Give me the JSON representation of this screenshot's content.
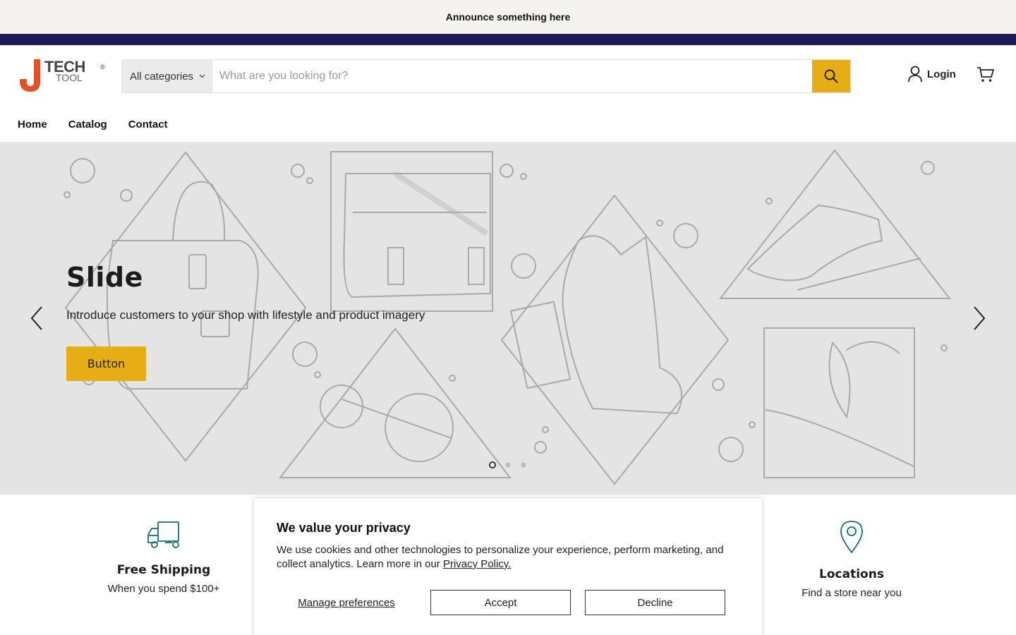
{
  "announcement": "Announce something here",
  "brand": {
    "tech": "TECH",
    "tool": "TOOL",
    "reg": "®",
    "accent": "#e2512a"
  },
  "search": {
    "category": "All categories",
    "placeholder": "What are you looking for?",
    "button_color": "#e6ad16"
  },
  "account": {
    "login_label": "Login"
  },
  "nav": {
    "items": [
      "Home",
      "Catalog",
      "Contact"
    ]
  },
  "hero": {
    "title": "Slide",
    "subtitle": "Introduce customers to your shop with lifestyle and product imagery",
    "button_label": "Button",
    "slides_total": 3,
    "active_slide": 1
  },
  "features": [
    {
      "icon": "truck-icon",
      "title": "Free Shipping",
      "subtitle": "When you spend $100+"
    },
    {
      "icon": "map-pin-icon",
      "title": "Locations",
      "subtitle": "Find a store near you"
    }
  ],
  "cookie": {
    "title": "We value your privacy",
    "text": "We use cookies and other technologies to personalize your experience, perform marketing, and collect analytics. Learn more in our ",
    "link_label": "Privacy Policy.",
    "manage_label": "Manage preferences",
    "accept_label": "Accept",
    "decline_label": "Decline"
  },
  "colors": {
    "navy": "#1b1a57",
    "accent_yellow": "#e6ad16",
    "icon_teal": "#1b6b78"
  }
}
